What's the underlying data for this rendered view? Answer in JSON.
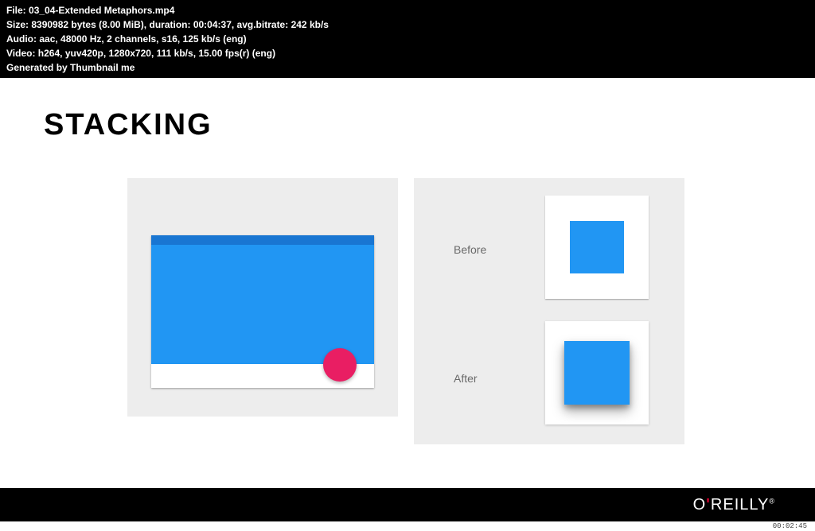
{
  "header": {
    "file_label": "File:",
    "file_value": "03_04-Extended Metaphors.mp4",
    "size_label": "Size:",
    "size_bytes": "8390982",
    "bytes_word": "bytes",
    "size_mib": "(8.00 MiB),",
    "duration_label": "duration:",
    "duration_value": "00:04:37,",
    "avgbitrate_label": "avg.bitrate:",
    "avgbitrate_value": "242",
    "kbps": "kb/s",
    "audio_label": "Audio:",
    "audio_codec": "aac,",
    "audio_hz": "48000",
    "hz_word": "Hz,",
    "audio_ch": "2",
    "channels_word": "channels,",
    "audio_fmt": "s16,",
    "audio_br": "125",
    "audio_lang": "(eng)",
    "video_label": "Video:",
    "video_codec": "h264,",
    "video_pix": "yuv420p,",
    "video_res": "1280x720,",
    "video_br": "111",
    "video_fps": "15.00",
    "fps_word": "fps(r)",
    "video_lang": "(eng)",
    "generated": "Generated by Thumbnail me"
  },
  "slide": {
    "title": "STACKING",
    "before_label": "Before",
    "after_label": "After"
  },
  "footer": {
    "brand_o": "O",
    "brand_apos": "'",
    "brand_reilly": "REILLY",
    "brand_reg": "®"
  },
  "timestamp": "00:02:45"
}
